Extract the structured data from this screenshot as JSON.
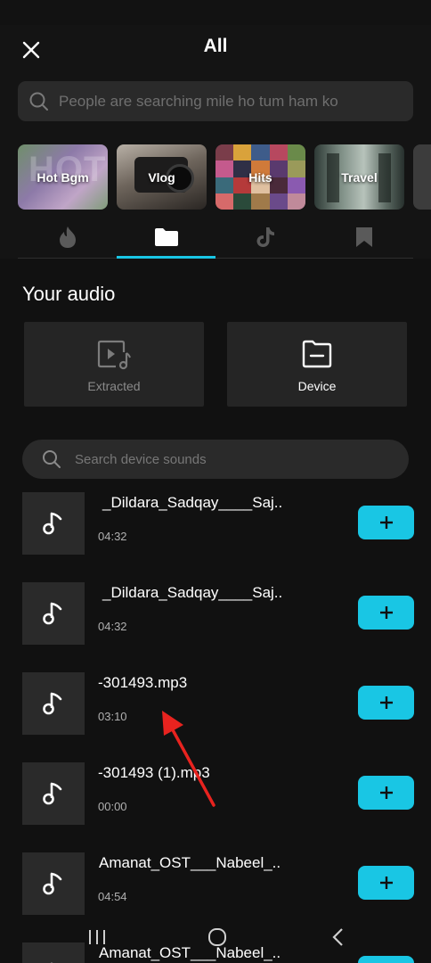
{
  "header": {
    "title": "All",
    "close_icon": "close-icon"
  },
  "search": {
    "placeholder": "People are searching mile ho tum ham ko",
    "icon": "search-icon"
  },
  "categories": [
    {
      "label": "Hot Bgm",
      "overlay_text": "HOT"
    },
    {
      "label": "Vlog"
    },
    {
      "label": "Hits"
    },
    {
      "label": "Travel"
    }
  ],
  "tabs": [
    {
      "icon": "flame-icon",
      "active": false
    },
    {
      "icon": "folder-icon",
      "active": true
    },
    {
      "icon": "tiktok-icon",
      "active": false
    },
    {
      "icon": "bookmark-icon",
      "active": false
    }
  ],
  "your_audio": {
    "title": "Your audio",
    "extracted_label": "Extracted",
    "device_label": "Device"
  },
  "device_search": {
    "placeholder": "Search device sounds"
  },
  "tracks": [
    {
      "name": "_Dildara_Sadqay____Saj..",
      "duration": "04:32"
    },
    {
      "name": "_Dildara_Sadqay____Saj..",
      "duration": "04:32"
    },
    {
      "name": "-301493.mp3",
      "duration": "03:10"
    },
    {
      "name": "-301493 (1).mp3",
      "duration": "00:00"
    },
    {
      "name": "Amanat_OST___Nabeel_..",
      "duration": "04:54"
    },
    {
      "name": "Amanat_OST___Nabeel_..",
      "duration": ""
    }
  ],
  "colors": {
    "accent": "#19c6e4",
    "background": "#111111",
    "card": "#252525",
    "annotation": "#e8231f"
  }
}
